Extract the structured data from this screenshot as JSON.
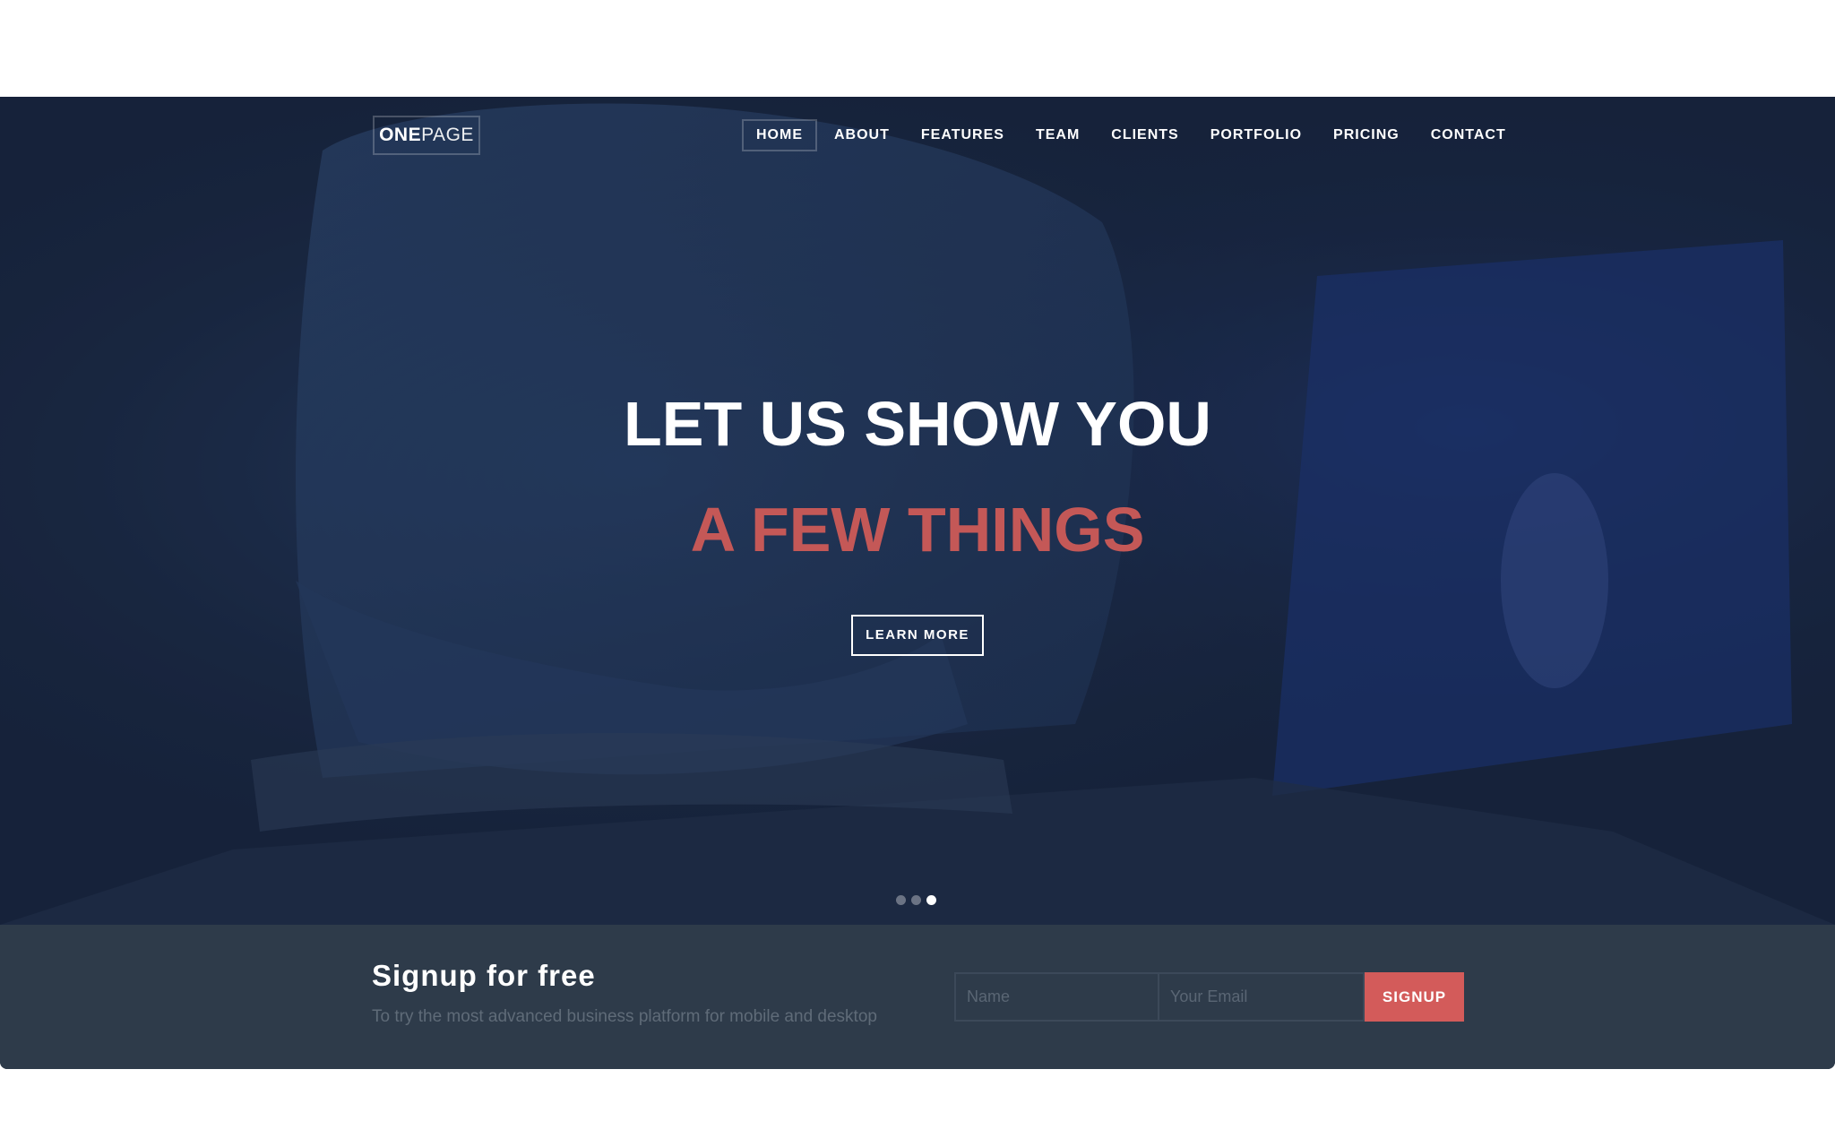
{
  "brand": {
    "logo_bold": "ONE",
    "logo_light": "PAGE"
  },
  "nav": {
    "items": [
      {
        "label": "HOME",
        "active": true
      },
      {
        "label": "ABOUT"
      },
      {
        "label": "FEATURES"
      },
      {
        "label": "TEAM"
      },
      {
        "label": "CLIENTS"
      },
      {
        "label": "PORTFOLIO"
      },
      {
        "label": "PRICING"
      },
      {
        "label": "CONTACT"
      }
    ]
  },
  "hero": {
    "title": "LET US SHOW YOU",
    "subtitle": "A FEW THINGS",
    "cta_label": "LEARN MORE",
    "slides_count": 3,
    "active_slide": 3
  },
  "signup": {
    "title": "Signup for free",
    "subtitle": "To try the most advanced business platform for mobile and desktop",
    "name_placeholder": "Name",
    "email_placeholder": "Your Email",
    "button_label": "SIGNUP"
  },
  "colors": {
    "accent": "#c45857",
    "button_accent": "#d35b5a",
    "hero_bg": "#17233a",
    "signup_bg": "#2e3b4a"
  }
}
